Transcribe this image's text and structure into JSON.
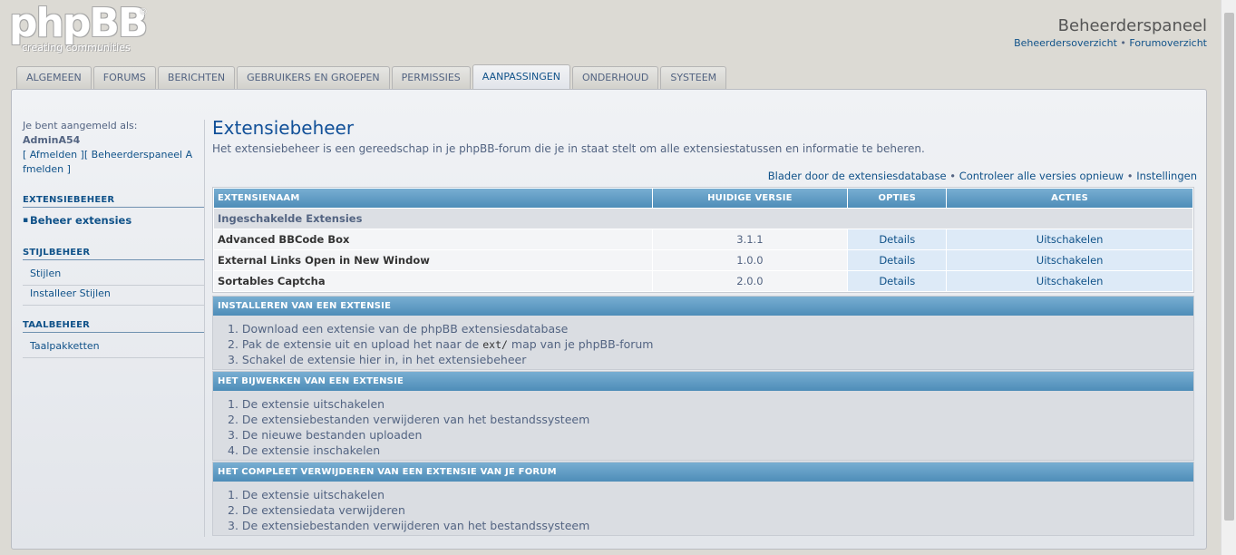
{
  "header": {
    "logo_main": "phpBB",
    "logo_reg": "®",
    "logo_tag": "creating communities",
    "acp_title": "Beheerderspaneel",
    "link_admin_index": "Beheerdersoverzicht",
    "link_separator": " • ",
    "link_forum_index": "Forumoverzicht"
  },
  "tabs": [
    {
      "label": "ALGEMEEN"
    },
    {
      "label": "FORUMS"
    },
    {
      "label": "BERICHTEN"
    },
    {
      "label": "GEBRUIKERS EN GROEPEN"
    },
    {
      "label": "PERMISSIES"
    },
    {
      "label": "AANPASSINGEN",
      "active": true
    },
    {
      "label": "ONDERHOUD"
    },
    {
      "label": "SYSTEEM"
    }
  ],
  "sidebar": {
    "login_label": "Je bent aangemeld als:",
    "login_user": "AdminA54",
    "login_links_line1": "[ Afmelden ][ Beheerderspaneel A",
    "login_links_line2": "fmelden ]",
    "sections": [
      {
        "heading": "EXTENSIEBEHEER",
        "items": [
          {
            "label": "Beheer extensies",
            "active": true
          }
        ]
      },
      {
        "heading": "STIJLBEHEER",
        "items": [
          {
            "label": "Stijlen"
          },
          {
            "label": "Installeer Stijlen"
          }
        ]
      },
      {
        "heading": "TAALBEHEER",
        "items": [
          {
            "label": "Taalpakketten"
          }
        ]
      }
    ]
  },
  "main": {
    "title": "Extensiebeheer",
    "description": "Het extensiebeheer is een gereedschap in je phpBB-forum die je in staat stelt om alle extensiestatussen en informatie te beheren.",
    "action_links": {
      "browse": "Blader door de extensiesdatabase",
      "separator": " • ",
      "recheck": "Controleer alle versies opnieuw",
      "settings": "Instellingen"
    },
    "table": {
      "headers": [
        "EXTENSIENAAM",
        "HUIDIGE VERSIE",
        "OPTIES",
        "ACTIES"
      ],
      "group_label": "Ingeschakelde Extensies",
      "rows": [
        {
          "name": "Advanced BBCode Box",
          "version": "3.1.1",
          "option": "Details",
          "action": "Uitschakelen"
        },
        {
          "name": "External Links Open in New Window",
          "version": "1.0.0",
          "option": "Details",
          "action": "Uitschakelen"
        },
        {
          "name": "Sortables Captcha",
          "version": "2.0.0",
          "option": "Details",
          "action": "Uitschakelen"
        }
      ]
    },
    "install": {
      "heading": "INSTALLEREN VAN EEN EXTENSIE",
      "step1": "1. Download een extensie van de phpBB extensiesdatabase",
      "step2_pre": "2. Pak de extensie uit en upload het naar de ",
      "step2_code": "ext/",
      "step2_post": " map van je phpBB-forum",
      "step3": "3. Schakel de extensie hier in, in het extensiebeheer"
    },
    "update": {
      "heading": "HET BIJWERKEN VAN EEN EXTENSIE",
      "steps": [
        "1. De extensie uitschakelen",
        "2. De extensiebestanden verwijderen van het bestandssysteem",
        "3. De nieuwe bestanden uploaden",
        "4. De extensie inschakelen"
      ]
    },
    "remove": {
      "heading": "HET COMPLEET VERWIJDEREN VAN EEN EXTENSIE VAN JE FORUM",
      "steps": [
        "1. De extensie uitschakelen",
        "2. De extensiedata verwijderen",
        "3. De extensiebestanden verwijderen van het bestandssysteem"
      ]
    }
  },
  "colors": {
    "page_bg": "#dcdad4",
    "link": "#105289",
    "header_blue": "#4e8db8",
    "title_blue": "#115098"
  }
}
